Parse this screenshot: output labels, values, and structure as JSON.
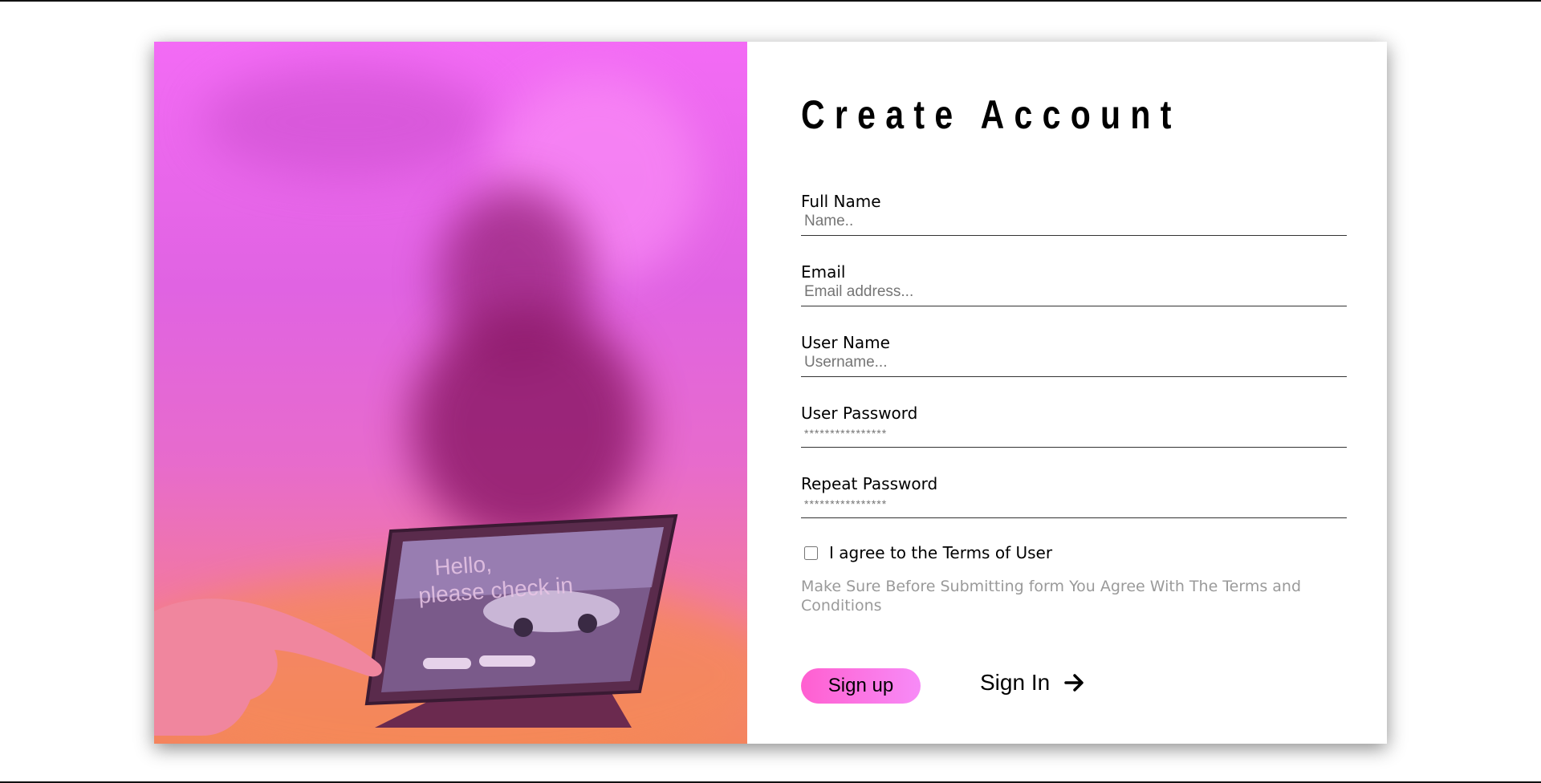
{
  "form": {
    "title": "Create Account",
    "fields": [
      {
        "label": "Full Name",
        "placeholder": "Name.."
      },
      {
        "label": "Email",
        "placeholder": "Email address..."
      },
      {
        "label": "User Name",
        "placeholder": "Username..."
      },
      {
        "label": "User Password",
        "placeholder": "****************"
      },
      {
        "label": "Repeat Password",
        "placeholder": "****************"
      }
    ],
    "agree_label": "I agree to the Terms of User",
    "agree_checked": false,
    "note": "Make Sure Before Submitting form You Agree With The Terms and Conditions",
    "signup_label": "Sign up",
    "signin_label": "Sign In",
    "signin_icon": "arrow-right-icon"
  },
  "hero": {
    "tablet_screen_text_1": "Hello,",
    "tablet_screen_text_2": "please check in"
  },
  "colors": {
    "hero_overlay": "#f36bf5",
    "signup_gradient_start": "#ff5fd0",
    "signup_gradient_end": "#f78bf7",
    "note_text": "#9a9a9a"
  }
}
